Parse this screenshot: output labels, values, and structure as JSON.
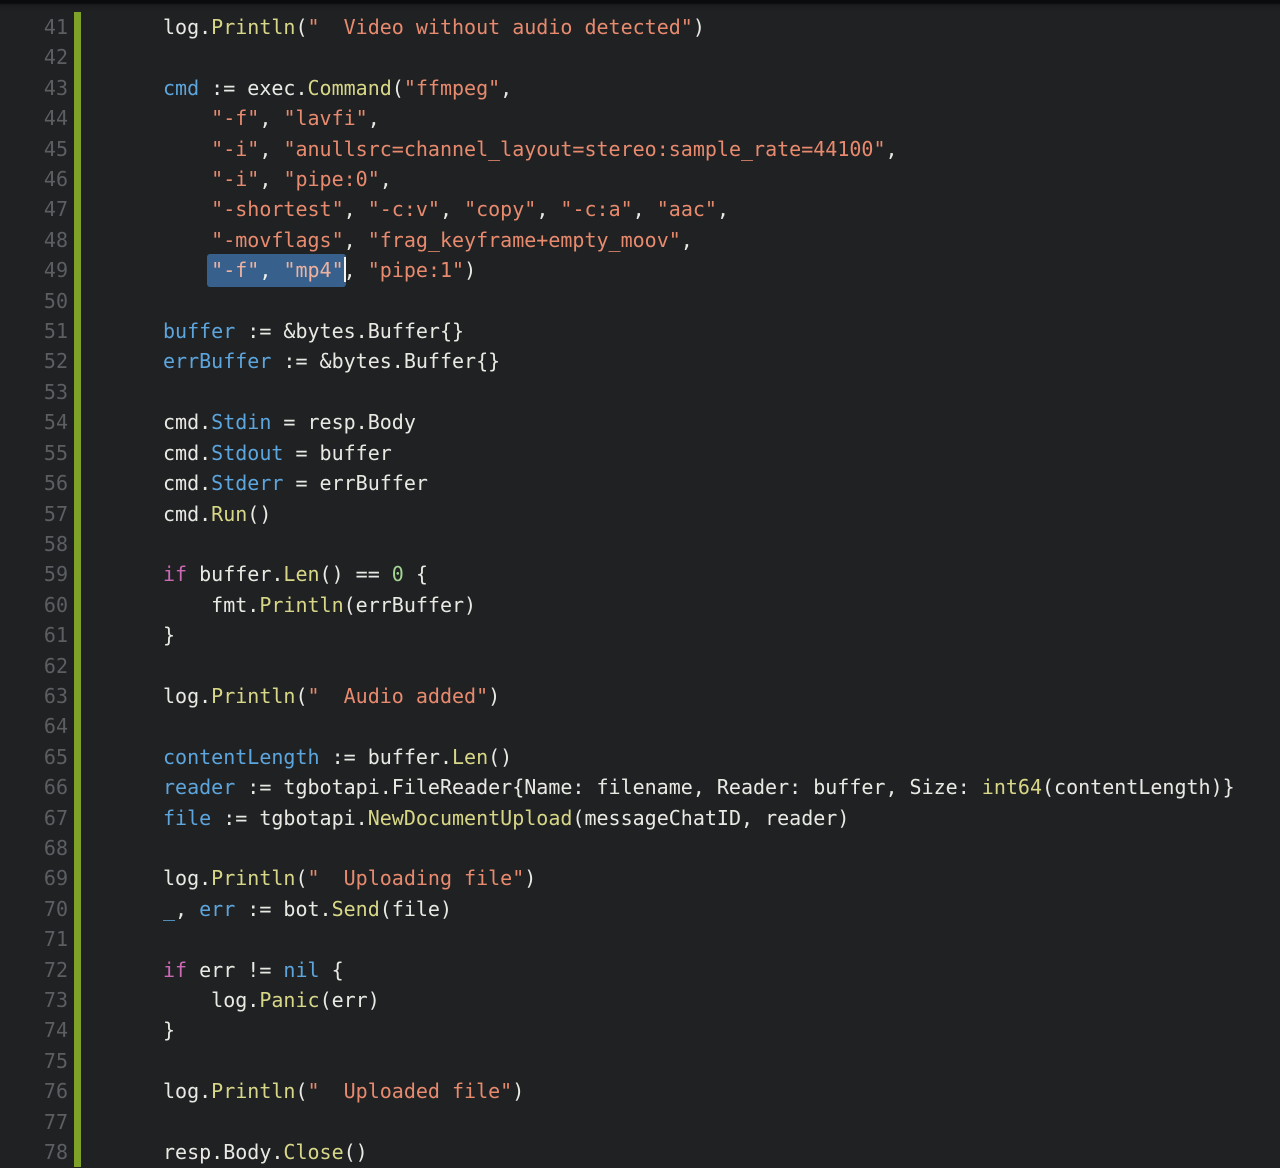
{
  "editor": {
    "language": "go",
    "colors": {
      "background": "#202123",
      "gutter_number": "#5b5f62",
      "modified_bar_green": "#7da227",
      "text_default": "#e9e9e4",
      "text_variable_blue": "#5ca5dd",
      "text_function_yellow": "#d7d787",
      "text_string_salmon": "#e78a6e",
      "text_keyword_pink": "#cd68b4",
      "text_number_green": "#a2d492",
      "selection_background": "#37618c",
      "selection_string_text": "#efb2a0",
      "cursor": "#f5f5f5"
    },
    "first_line_number": 41,
    "last_line_number": 78,
    "lines": [
      {
        "n": 41,
        "i": 0,
        "t": [
          [
            "d",
            "log."
          ],
          [
            "f",
            "Println"
          ],
          [
            "d",
            "("
          ],
          [
            "s",
            "\"  Video without audio detected\""
          ],
          [
            "d",
            ")"
          ]
        ]
      },
      {
        "n": 42,
        "i": 0,
        "t": []
      },
      {
        "n": 43,
        "i": 0,
        "t": [
          [
            "v",
            "cmd"
          ],
          [
            "d",
            " := exec."
          ],
          [
            "f",
            "Command"
          ],
          [
            "d",
            "("
          ],
          [
            "s",
            "\"ffmpeg\""
          ],
          [
            "d",
            ","
          ]
        ]
      },
      {
        "n": 44,
        "i": 1,
        "t": [
          [
            "s",
            "\"-f\""
          ],
          [
            "d",
            ", "
          ],
          [
            "s",
            "\"lavfi\""
          ],
          [
            "d",
            ","
          ]
        ]
      },
      {
        "n": 45,
        "i": 1,
        "t": [
          [
            "s",
            "\"-i\""
          ],
          [
            "d",
            ", "
          ],
          [
            "s",
            "\"anullsrc=channel_layout=stereo:sample_rate=44100\""
          ],
          [
            "d",
            ","
          ]
        ]
      },
      {
        "n": 46,
        "i": 1,
        "t": [
          [
            "s",
            "\"-i\""
          ],
          [
            "d",
            ", "
          ],
          [
            "s",
            "\"pipe:0\""
          ],
          [
            "d",
            ","
          ]
        ]
      },
      {
        "n": 47,
        "i": 1,
        "t": [
          [
            "s",
            "\"-shortest\""
          ],
          [
            "d",
            ", "
          ],
          [
            "s",
            "\"-c:v\""
          ],
          [
            "d",
            ", "
          ],
          [
            "s",
            "\"copy\""
          ],
          [
            "d",
            ", "
          ],
          [
            "s",
            "\"-c:a\""
          ],
          [
            "d",
            ", "
          ],
          [
            "s",
            "\"aac\""
          ],
          [
            "d",
            ","
          ]
        ]
      },
      {
        "n": 48,
        "i": 1,
        "t": [
          [
            "s",
            "\"-movflags\""
          ],
          [
            "d",
            ", "
          ],
          [
            "s",
            "\"frag_keyframe+empty_moov\""
          ],
          [
            "d",
            ","
          ]
        ]
      },
      {
        "n": 49,
        "i": 1,
        "t": [
          [
            "s",
            "\"-f\"",
            "sel"
          ],
          [
            "d",
            ", ",
            "sel"
          ],
          [
            "s",
            "\"mp4\"",
            "sel"
          ],
          [
            "cur",
            ""
          ],
          [
            "d",
            ", "
          ],
          [
            "s",
            "\"pipe:1\""
          ],
          [
            "d",
            ")"
          ]
        ]
      },
      {
        "n": 50,
        "i": 0,
        "t": []
      },
      {
        "n": 51,
        "i": 0,
        "t": [
          [
            "v",
            "buffer"
          ],
          [
            "d",
            " := &bytes.Buffer{}"
          ]
        ]
      },
      {
        "n": 52,
        "i": 0,
        "t": [
          [
            "v",
            "errBuffer"
          ],
          [
            "d",
            " := &bytes.Buffer{}"
          ]
        ]
      },
      {
        "n": 53,
        "i": 0,
        "t": []
      },
      {
        "n": 54,
        "i": 0,
        "t": [
          [
            "d",
            "cmd."
          ],
          [
            "v",
            "Stdin"
          ],
          [
            "d",
            " = resp.Body"
          ]
        ]
      },
      {
        "n": 55,
        "i": 0,
        "t": [
          [
            "d",
            "cmd."
          ],
          [
            "v",
            "Stdout"
          ],
          [
            "d",
            " = buffer"
          ]
        ]
      },
      {
        "n": 56,
        "i": 0,
        "t": [
          [
            "d",
            "cmd."
          ],
          [
            "v",
            "Stderr"
          ],
          [
            "d",
            " = errBuffer"
          ]
        ]
      },
      {
        "n": 57,
        "i": 0,
        "t": [
          [
            "d",
            "cmd."
          ],
          [
            "f",
            "Run"
          ],
          [
            "d",
            "()"
          ]
        ]
      },
      {
        "n": 58,
        "i": 0,
        "t": []
      },
      {
        "n": 59,
        "i": 0,
        "t": [
          [
            "k",
            "if"
          ],
          [
            "d",
            " buffer."
          ],
          [
            "f",
            "Len"
          ],
          [
            "d",
            "() == "
          ],
          [
            "n",
            "0"
          ],
          [
            "d",
            " {"
          ]
        ]
      },
      {
        "n": 60,
        "i": 1,
        "t": [
          [
            "d",
            "fmt."
          ],
          [
            "f",
            "Println"
          ],
          [
            "d",
            "(errBuffer)"
          ]
        ]
      },
      {
        "n": 61,
        "i": 0,
        "t": [
          [
            "d",
            "}"
          ]
        ]
      },
      {
        "n": 62,
        "i": 0,
        "t": []
      },
      {
        "n": 63,
        "i": 0,
        "t": [
          [
            "d",
            "log."
          ],
          [
            "f",
            "Println"
          ],
          [
            "d",
            "("
          ],
          [
            "s",
            "\"  Audio added\""
          ],
          [
            "d",
            ")"
          ]
        ]
      },
      {
        "n": 64,
        "i": 0,
        "t": []
      },
      {
        "n": 65,
        "i": 0,
        "t": [
          [
            "v",
            "contentLength"
          ],
          [
            "d",
            " := buffer."
          ],
          [
            "f",
            "Len"
          ],
          [
            "d",
            "()"
          ]
        ]
      },
      {
        "n": 66,
        "i": 0,
        "t": [
          [
            "v",
            "reader"
          ],
          [
            "d",
            " := tgbotapi.FileReader{Name: filename, Reader: buffer, Size: "
          ],
          [
            "f",
            "int64"
          ],
          [
            "d",
            "(contentLength)}"
          ]
        ]
      },
      {
        "n": 67,
        "i": 0,
        "t": [
          [
            "v",
            "file"
          ],
          [
            "d",
            " := tgbotapi."
          ],
          [
            "f",
            "NewDocumentUpload"
          ],
          [
            "d",
            "(messageChatID, reader)"
          ]
        ]
      },
      {
        "n": 68,
        "i": 0,
        "t": []
      },
      {
        "n": 69,
        "i": 0,
        "t": [
          [
            "d",
            "log."
          ],
          [
            "f",
            "Println"
          ],
          [
            "d",
            "("
          ],
          [
            "s",
            "\"  Uploading file\""
          ],
          [
            "d",
            ")"
          ]
        ]
      },
      {
        "n": 70,
        "i": 0,
        "t": [
          [
            "v",
            "_"
          ],
          [
            "d",
            ", "
          ],
          [
            "v",
            "err"
          ],
          [
            "d",
            " := bot."
          ],
          [
            "f",
            "Send"
          ],
          [
            "d",
            "(file)"
          ]
        ]
      },
      {
        "n": 71,
        "i": 0,
        "t": []
      },
      {
        "n": 72,
        "i": 0,
        "t": [
          [
            "k",
            "if"
          ],
          [
            "d",
            " err != "
          ],
          [
            "v",
            "nil"
          ],
          [
            "d",
            " {"
          ]
        ]
      },
      {
        "n": 73,
        "i": 1,
        "t": [
          [
            "d",
            "log."
          ],
          [
            "f",
            "Panic"
          ],
          [
            "d",
            "(err)"
          ]
        ]
      },
      {
        "n": 74,
        "i": 0,
        "t": [
          [
            "d",
            "}"
          ]
        ]
      },
      {
        "n": 75,
        "i": 0,
        "t": []
      },
      {
        "n": 76,
        "i": 0,
        "t": [
          [
            "d",
            "log."
          ],
          [
            "f",
            "Println"
          ],
          [
            "d",
            "("
          ],
          [
            "s",
            "\"  Uploaded file\""
          ],
          [
            "d",
            ")"
          ]
        ]
      },
      {
        "n": 77,
        "i": 0,
        "t": []
      },
      {
        "n": 78,
        "i": 0,
        "t": [
          [
            "d",
            "resp.Body."
          ],
          [
            "f",
            "Close"
          ],
          [
            "d",
            "()"
          ]
        ]
      }
    ]
  }
}
